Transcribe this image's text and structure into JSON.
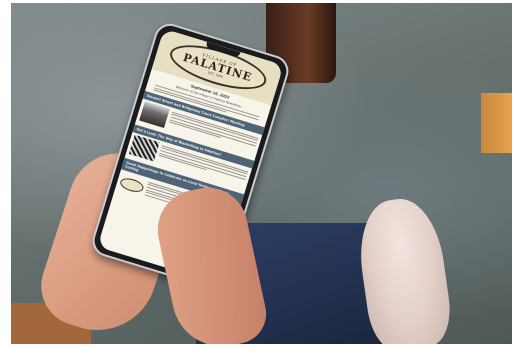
{
  "screen": {
    "logo": {
      "top": "VILLAGE OF",
      "main": "PALATINE",
      "bottom": "EST. 1866"
    },
    "date": "September 16, 2022",
    "greeting": "Welcome to the Village of Palatine Newsletter",
    "sections": [
      {
        "heading": "Stewart Street and Bridgeway Court Complex: Meeting"
      },
      {
        "heading": "Get a Look: The Way of Blanketbag to Palatine?"
      },
      {
        "heading": "Great Happenings to Celebrate on Local Restaurant Days: Coming"
      }
    ]
  }
}
